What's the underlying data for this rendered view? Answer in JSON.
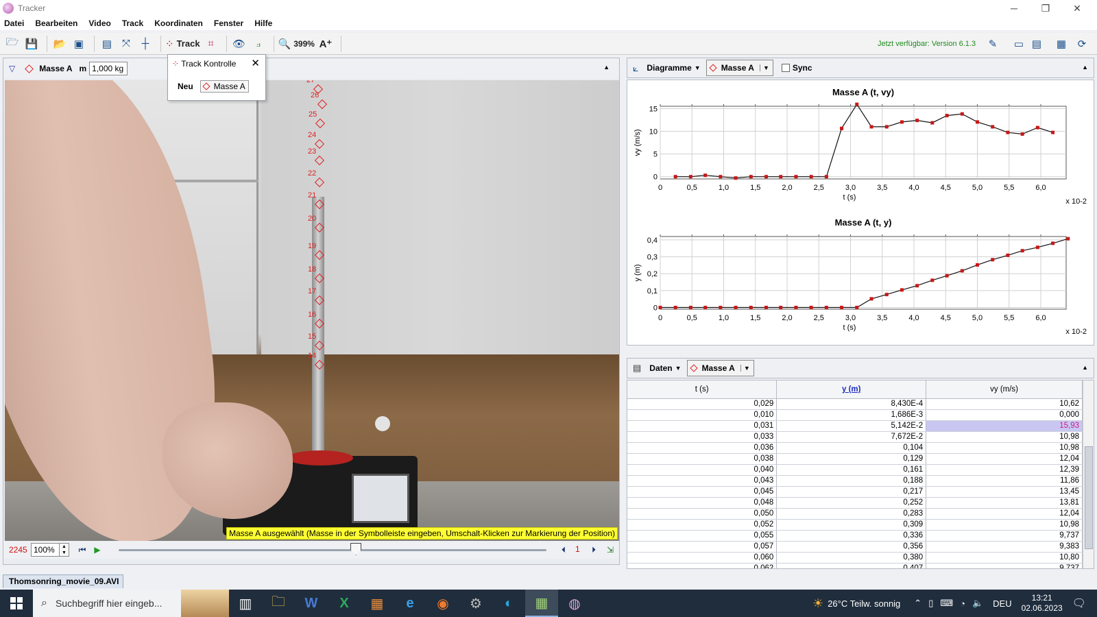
{
  "window": {
    "title": "Tracker"
  },
  "menu": [
    "Datei",
    "Bearbeiten",
    "Video",
    "Track",
    "Koordinaten",
    "Fenster",
    "Hilfe"
  ],
  "toolbar": {
    "track_label": "Track",
    "zoom_label": "399%",
    "update_note": "Jetzt verfügbar: Version 6.1.3"
  },
  "track_bar": {
    "track_name": "Masse A",
    "mass_label": "m",
    "mass_value": "1,000 kg"
  },
  "track_control": {
    "title": "Track Kontrolle",
    "new_label": "Neu",
    "track_button": "Masse A"
  },
  "video": {
    "status_message": "Masse A ausgewählt (Masse in der Symbolleiste eingeben, Umschalt-Klicken zur Markierung der Position)",
    "frame_number": "2245",
    "zoom": "100%",
    "step_size": "1",
    "file_tab": "Thomsonring_movie_09.AVI",
    "marker_labels": [
      "27",
      "26",
      "25",
      "24",
      "23",
      "22",
      "21",
      "20",
      "19",
      "18",
      "17",
      "16",
      "15",
      "14"
    ]
  },
  "plot_panel": {
    "view_label": "Diagramme",
    "track": "Masse A",
    "sync_label": "Sync"
  },
  "chart_data": [
    {
      "type": "line",
      "title": "Masse A (t, vy)",
      "xlabel": "t (s)",
      "ylabel": "vy (m/s)",
      "x_multiplier": "x 10-2",
      "xlim": [
        0,
        6.4
      ],
      "ylim": [
        -0.5,
        15.5
      ],
      "x_ticks": [
        "0",
        "0,5",
        "1,0",
        "1,5",
        "2,0",
        "2,5",
        "3,0",
        "3,5",
        "4,0",
        "4,5",
        "5,0",
        "5,5",
        "6,0"
      ],
      "y_ticks": [
        "0",
        "5",
        "10",
        "15"
      ],
      "x": [
        0.24,
        0.48,
        0.71,
        0.95,
        1.19,
        1.43,
        1.67,
        1.9,
        2.14,
        2.38,
        2.62,
        2.86,
        3.1,
        3.33,
        3.57,
        3.81,
        4.05,
        4.29,
        4.52,
        4.76,
        5.0,
        5.24,
        5.48,
        5.71,
        5.95,
        6.19
      ],
      "y": [
        0.0,
        0.0,
        0.3,
        0.0,
        -0.3,
        0.0,
        0.0,
        0.0,
        0.0,
        0.0,
        0.0,
        10.62,
        15.93,
        10.98,
        10.98,
        12.04,
        12.39,
        11.86,
        13.45,
        13.81,
        12.04,
        10.98,
        9.737,
        9.383,
        10.8,
        9.737
      ]
    },
    {
      "type": "line",
      "title": "Masse A (t, y)",
      "xlabel": "t (s)",
      "ylabel": "y (m)",
      "x_multiplier": "x 10-2",
      "xlim": [
        0,
        6.4
      ],
      "ylim": [
        -0.01,
        0.42
      ],
      "x_ticks": [
        "0",
        "0,5",
        "1,0",
        "1,5",
        "2,0",
        "2,5",
        "3,0",
        "3,5",
        "4,0",
        "4,5",
        "5,0",
        "5,5",
        "6,0"
      ],
      "y_ticks": [
        "0",
        "0,1",
        "0,2",
        "0,3",
        "0,4"
      ],
      "x": [
        0.0,
        0.24,
        0.48,
        0.71,
        0.95,
        1.19,
        1.43,
        1.67,
        1.9,
        2.14,
        2.38,
        2.62,
        2.86,
        3.1,
        3.33,
        3.57,
        3.81,
        4.05,
        4.29,
        4.52,
        4.76,
        5.0,
        5.24,
        5.48,
        5.71,
        5.95,
        6.19,
        6.43
      ],
      "y": [
        0.0,
        0.0,
        0.0,
        0.0,
        0.0,
        0.0,
        0.0,
        0.0,
        0.0,
        0.0,
        0.0,
        0.0,
        0.0,
        0.0,
        0.05142,
        0.07672,
        0.104,
        0.129,
        0.161,
        0.188,
        0.217,
        0.252,
        0.283,
        0.309,
        0.336,
        0.356,
        0.38,
        0.407
      ]
    }
  ],
  "data_panel": {
    "view_label": "Daten",
    "track": "Masse A",
    "columns": [
      "t (s)",
      "y (m)",
      "vy (m/s)"
    ],
    "rows": [
      [
        "0,029",
        "8,430E-4",
        "10,62"
      ],
      [
        "0,010",
        "1,686E-3",
        "0,000"
      ],
      [
        "0,031",
        "5,142E-2",
        "15,93"
      ],
      [
        "0,033",
        "7,672E-2",
        "10,98"
      ],
      [
        "0,036",
        "0,104",
        "10,98"
      ],
      [
        "0,038",
        "0,129",
        "12,04"
      ],
      [
        "0,040",
        "0,161",
        "12,39"
      ],
      [
        "0,043",
        "0,188",
        "11,86"
      ],
      [
        "0,045",
        "0,217",
        "13,45"
      ],
      [
        "0,048",
        "0,252",
        "13,81"
      ],
      [
        "0,050",
        "0,283",
        "12,04"
      ],
      [
        "0,052",
        "0,309",
        "10,98"
      ],
      [
        "0,055",
        "0,336",
        "9,737"
      ],
      [
        "0,057",
        "0,356",
        "9,383"
      ],
      [
        "0,060",
        "0,380",
        "10,80"
      ],
      [
        "0,062",
        "0,407",
        "9,737"
      ]
    ],
    "highlight_row": 2
  },
  "taskbar": {
    "search_placeholder": "Suchbegriff hier eingeb...",
    "weather": "26°C  Teilw. sonnig",
    "language": "DEU",
    "time": "13:21",
    "date": "02.06.2023"
  },
  "colors": {
    "track_red": "#e02020",
    "highlight": "#c9c7f2"
  }
}
